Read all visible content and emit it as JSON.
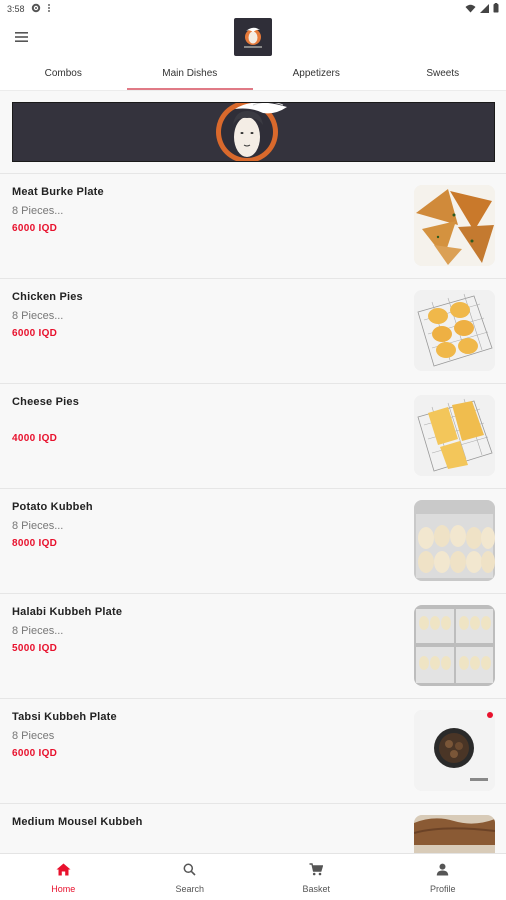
{
  "status_bar": {
    "time": "3:58"
  },
  "app": {
    "accent_color": "#e8112d",
    "logo_bg": "#2f2e38"
  },
  "tabs": [
    {
      "label": "Combos"
    },
    {
      "label": "Main Dishes",
      "active": true
    },
    {
      "label": "Appetizers"
    },
    {
      "label": "Sweets"
    }
  ],
  "items": [
    {
      "name": "Meat Burke Plate",
      "desc": "8 Pieces...",
      "price": "6000 IQD",
      "image": "fried-pastries"
    },
    {
      "name": "Chicken Pies",
      "desc": "8 Pieces...",
      "price": "6000 IQD",
      "image": "pies-on-rack"
    },
    {
      "name": "Cheese Pies",
      "desc": "",
      "price": "4000 IQD",
      "image": "cheese-pies-on-rack"
    },
    {
      "name": "Potato Kubbeh",
      "desc": "8 Pieces...",
      "price": "8000 IQD",
      "image": "potato-kubbeh-tray"
    },
    {
      "name": "Halabi Kubbeh Plate",
      "desc": "8 Pieces...",
      "price": "5000 IQD",
      "image": "halabi-kubbeh-trays"
    },
    {
      "name": "Tabsi Kubbeh Plate",
      "desc": "8 Pieces",
      "price": "6000 IQD",
      "image": "tabsi-bowl"
    },
    {
      "name": "Medium Mousel Kubbeh",
      "desc": "",
      "price": "",
      "image": "mousel-kubbeh"
    }
  ],
  "bottom_nav": [
    {
      "label": "Home",
      "icon": "home-icon",
      "active": true
    },
    {
      "label": "Search",
      "icon": "search-icon"
    },
    {
      "label": "Basket",
      "icon": "cart-icon"
    },
    {
      "label": "Profile",
      "icon": "person-icon"
    }
  ]
}
